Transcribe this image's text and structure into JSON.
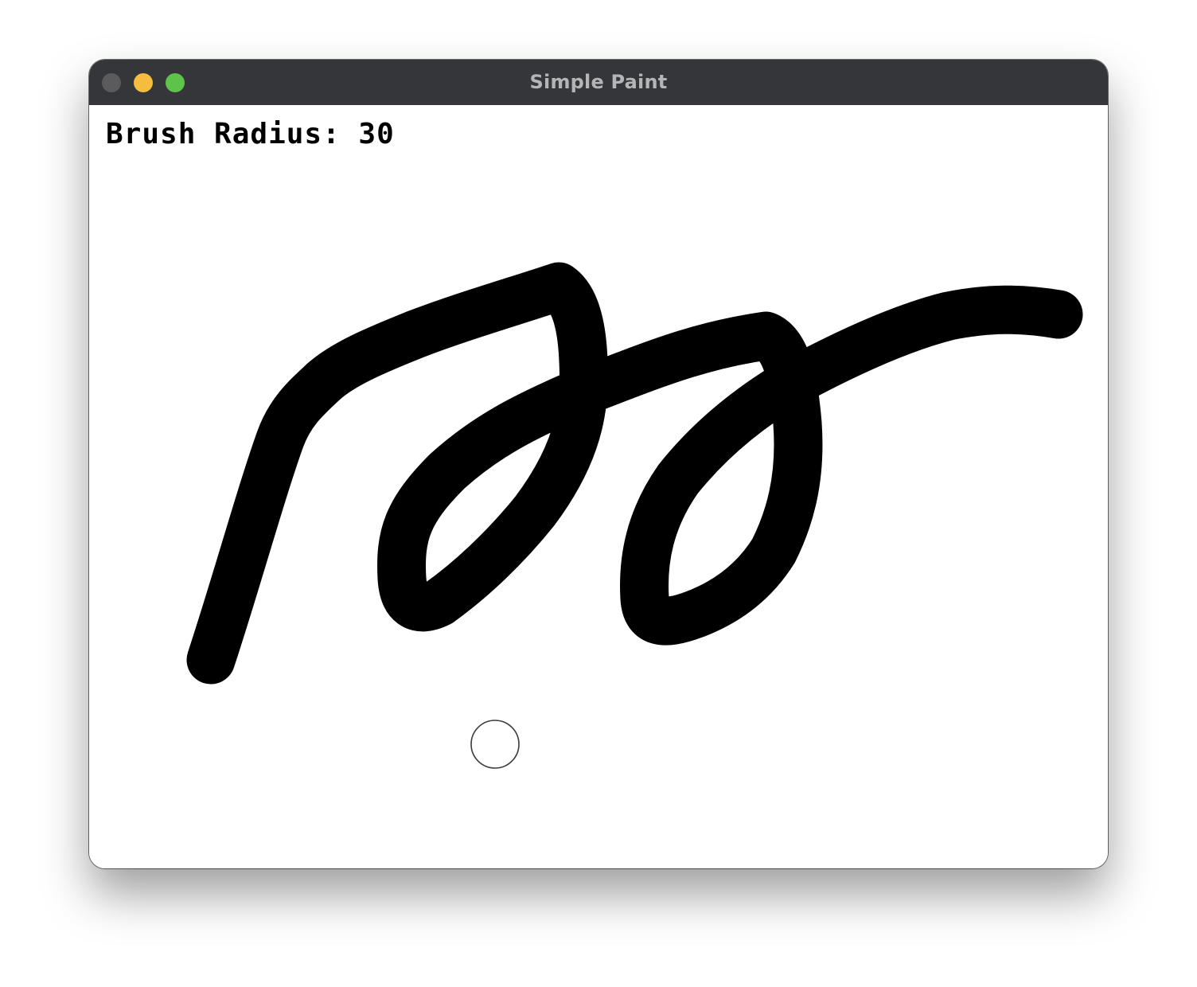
{
  "window": {
    "title": "Simple Paint",
    "traffic_lights": [
      {
        "name": "close",
        "color": "#5b5b5e"
      },
      {
        "name": "minimize",
        "color": "#f4bd3f"
      },
      {
        "name": "zoom",
        "color": "#5ec449"
      }
    ]
  },
  "canvas": {
    "background": "#ffffff",
    "stroke_color": "#000000",
    "status_text": "Brush Radius: 30",
    "brush_radius": 30
  }
}
